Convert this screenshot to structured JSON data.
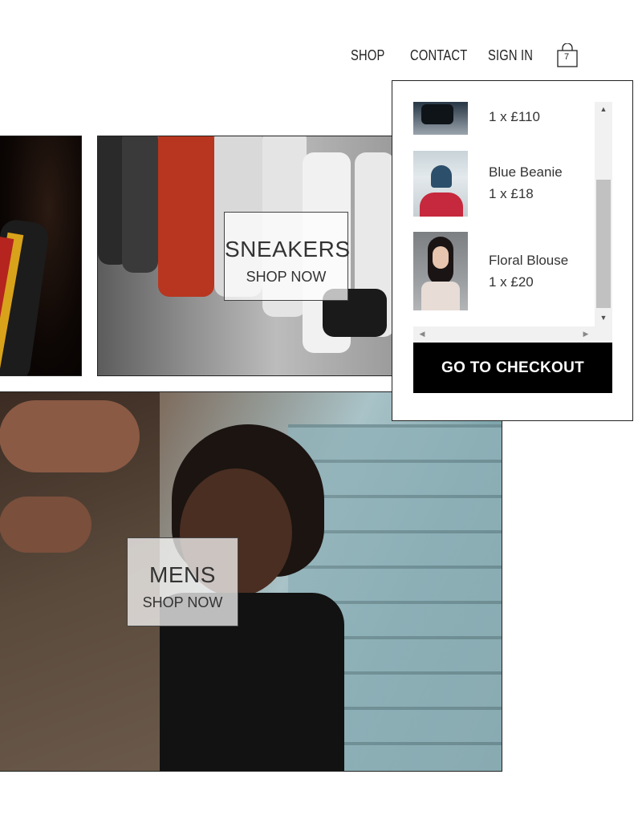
{
  "nav": {
    "shop": "SHOP",
    "contact": "CONTACT",
    "sign_in": "SIGN IN",
    "cart_count": "7",
    "cart_icon": "shopping-bag-icon"
  },
  "collections": {
    "sneakers": {
      "title": "SNEAKERS",
      "cta": "SHOP NOW"
    },
    "mens": {
      "title": "MENS",
      "cta": "SHOP NOW"
    }
  },
  "cart_dropdown": {
    "items": [
      {
        "name": "",
        "quantity_price": "1 x £110"
      },
      {
        "name": "Blue Beanie",
        "quantity_price": "1 x £18"
      },
      {
        "name": "Floral Blouse",
        "quantity_price": "1 x £20"
      }
    ],
    "checkout_label": "GO TO CHECKOUT"
  },
  "colors": {
    "checkout_bg": "#000000",
    "scrollbar_track": "#f1f1f1",
    "scrollbar_thumb": "#c1c1c1"
  }
}
